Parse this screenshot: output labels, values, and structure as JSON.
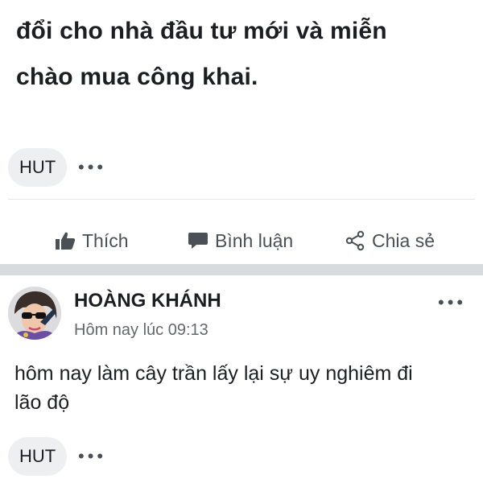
{
  "post1": {
    "text_lines": [
      "đổi cho nhà đầu tư mới và miễn",
      "chào mua công khai."
    ],
    "tag_label": "HUT",
    "more_label": "•••"
  },
  "actions": {
    "like_label": "Thích",
    "comment_label": "Bình luận",
    "share_label": "Chia sẻ"
  },
  "post2": {
    "author": "HOÀNG KHÁNH",
    "time": "Hôm nay lúc 09:13",
    "text_lines": [
      "hôm nay làm cây trần lấy lại sự uy nghiêm đi",
      "lão độ"
    ],
    "tag_label": "HUT",
    "more_label": "•••",
    "header_more_label": "•••"
  },
  "icons": {
    "like": "thumbs-up-icon",
    "comment": "speech-bubble-icon",
    "share": "share-icon"
  },
  "colors": {
    "text": "#1c1e21",
    "secondary_text": "#65676b",
    "action_text": "#4b4f56",
    "chip_bg": "#eeeff1",
    "section_gap": "#d9dadd"
  }
}
